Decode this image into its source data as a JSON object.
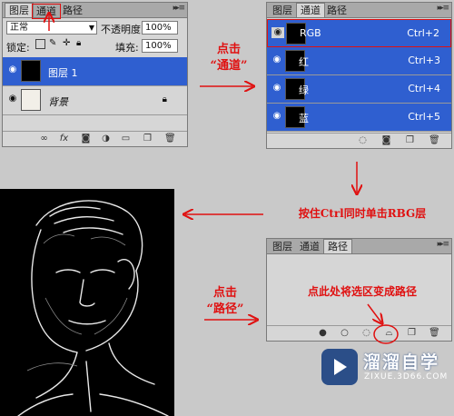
{
  "layers_panel": {
    "tabs": [
      "图层",
      "通道",
      "路径"
    ],
    "blend_mode": "正常",
    "opacity_label": "不透明度:",
    "opacity_value": "100%",
    "lock_label": "锁定:",
    "fill_label": "填充:",
    "fill_value": "100%",
    "layers": [
      {
        "name": "图层 1",
        "selected": true
      },
      {
        "name": "背景",
        "selected": false
      }
    ]
  },
  "channels_panel": {
    "tabs": [
      "图层",
      "通道",
      "路径"
    ],
    "channels": [
      {
        "name": "RGB",
        "shortcut": "Ctrl+2"
      },
      {
        "name": "红",
        "shortcut": "Ctrl+3"
      },
      {
        "name": "绿",
        "shortcut": "Ctrl+4"
      },
      {
        "name": "蓝",
        "shortcut": "Ctrl+5"
      }
    ]
  },
  "paths_panel": {
    "tabs": [
      "图层",
      "通道",
      "路径"
    ]
  },
  "annotations": {
    "click_channels": [
      "点击",
      "“通道”"
    ],
    "ctrl_click": "按住Ctrl同时单击RBG层",
    "click_paths": [
      "点击",
      "“路径”"
    ],
    "make_path": "点此处将选区变成路径"
  },
  "watermark": {
    "brand": "溜溜自学",
    "url": "ZIXUE.3D66.COM"
  },
  "colors": {
    "accent_red": "#e01010",
    "selection_blue": "#2f5fd0",
    "panel_gray": "#d6d6d6"
  }
}
